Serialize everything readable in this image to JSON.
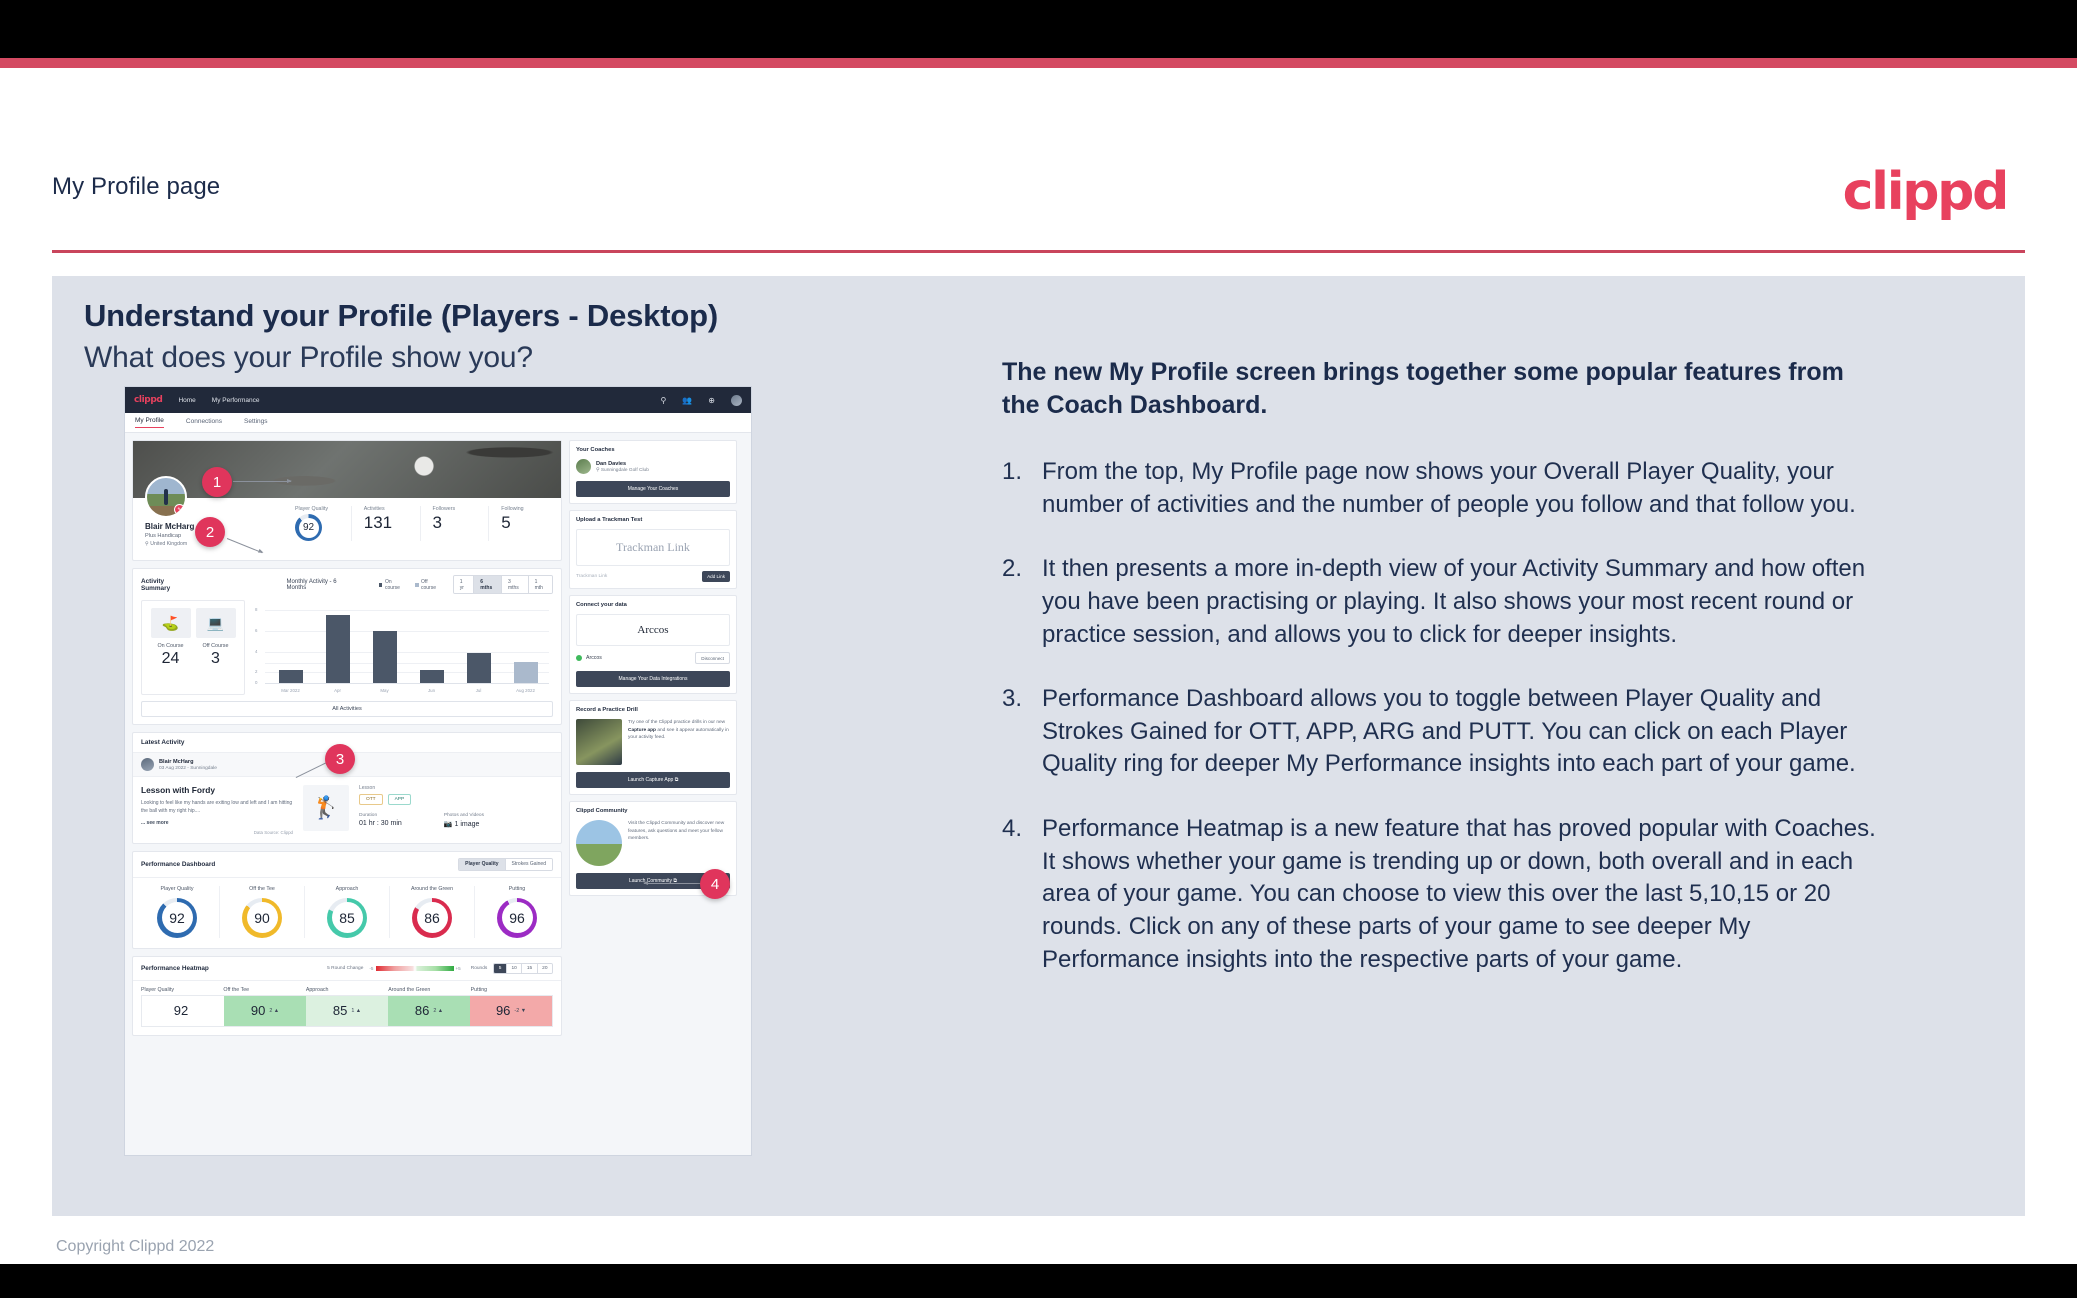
{
  "slide": {
    "title": "My Profile page",
    "logo": "clippd",
    "heading": "Understand your Profile (Players - Desktop)",
    "subheading": "What does your Profile show you?",
    "copyright": "Copyright Clippd 2022"
  },
  "copy": {
    "lede": "The new My Profile screen brings together some popular features from the Coach Dashboard.",
    "items": [
      {
        "num": "1.",
        "text": "From the top, My Profile page now shows your Overall Player Quality, your number of activities and the number of people you follow and that follow you."
      },
      {
        "num": "2.",
        "text": "It then presents a more in-depth view of your Activity Summary and how often you have been practising or playing. It also shows your most recent round or practice session, and allows you to click for deeper insights."
      },
      {
        "num": "3.",
        "text": "Performance Dashboard allows you to toggle between Player Quality and Strokes Gained for OTT, APP, ARG and PUTT. You can click on each Player Quality ring for deeper My Performance insights into each part of your game."
      },
      {
        "num": "4.",
        "text": "Performance Heatmap is a new feature that has proved popular with Coaches. It shows whether your game is trending up or down, both overall and in each area of your game. You can choose to view this over the last 5,10,15 or 20 rounds. Click on any of these parts of your game to see deeper My Performance insights into the respective parts of your game."
      }
    ]
  },
  "markers": [
    "1",
    "2",
    "3",
    "4"
  ],
  "app": {
    "nav": {
      "logo": "clippd",
      "links": [
        "Home",
        "My Performance"
      ],
      "icons": [
        "search-icon",
        "people-icon",
        "add-circle-icon",
        "avatar-icon"
      ]
    },
    "tabs": [
      {
        "label": "My Profile",
        "active": true
      },
      {
        "label": "Connections",
        "active": false
      },
      {
        "label": "Settings",
        "active": false
      }
    ],
    "profile": {
      "name": "Blair McHarg",
      "handicap": "Plus Handicap",
      "location": "United Kingdom",
      "stats": [
        {
          "label": "Player Quality",
          "value": "92",
          "ring": true
        },
        {
          "label": "Activities",
          "value": "131",
          "ring": false
        },
        {
          "label": "Followers",
          "value": "3",
          "ring": false
        },
        {
          "label": "Following",
          "value": "5",
          "ring": false
        }
      ]
    },
    "activity_summary": {
      "title": "Activity Summary",
      "chart_title": "Monthly Activity - 6 Months",
      "legend": [
        "On course",
        "Off course"
      ],
      "range_options": [
        "1 yr",
        "6 mths",
        "3 mths",
        "1 mth"
      ],
      "range_selected": "6 mths",
      "tiles": [
        {
          "label": "On Course",
          "value": "24",
          "icon": "flag-green-icon"
        },
        {
          "label": "Off Course",
          "value": "3",
          "icon": "monitor-icon"
        }
      ],
      "all_activities": "All Activities"
    },
    "latest_activity": {
      "title": "Latest Activity",
      "user": "Blair McHarg",
      "date": "03 Aug 2022 - Sunningdale",
      "headline": "Lesson with Fordy",
      "body": "Looking to feel like my hands are exiting low and left and I am hitting the ball with my right hip....",
      "see_more": "... see more",
      "source": "Data Source: Clippd",
      "type_label": "Lesson",
      "tags": [
        "OTT",
        "APP"
      ],
      "duration_label": "Duration",
      "duration_value": "01 hr : 30 min",
      "media_label": "Photos and Videos",
      "media_value": "1 image"
    },
    "performance_dashboard": {
      "title": "Performance Dashboard",
      "toggle": [
        "Player Quality",
        "Strokes Gained"
      ],
      "toggle_selected": "Player Quality",
      "rings": [
        {
          "label": "Player Quality",
          "value": "92",
          "class": "r-pq"
        },
        {
          "label": "Off the Tee",
          "value": "90",
          "class": "r-ott"
        },
        {
          "label": "Approach",
          "value": "85",
          "class": "r-app"
        },
        {
          "label": "Around the Green",
          "value": "86",
          "class": "r-arg"
        },
        {
          "label": "Putting",
          "value": "96",
          "class": "r-put"
        }
      ]
    },
    "heatmap": {
      "title": "Performance Heatmap",
      "scale_label": "5 Round Change",
      "scale_min": "-5",
      "scale_max": "+5",
      "rounds_label": "Rounds",
      "rounds_options": [
        "5",
        "10",
        "15",
        "20"
      ],
      "rounds_selected": "5",
      "cells": [
        {
          "label": "Player Quality",
          "value": "92",
          "delta": "",
          "bg": "#ffffff"
        },
        {
          "label": "Off the Tee",
          "value": "90",
          "delta": "2 ▲",
          "bg": "#a9dfb4"
        },
        {
          "label": "Approach",
          "value": "85",
          "delta": "1 ▲",
          "bg": "#dcf1e0"
        },
        {
          "label": "Around the Green",
          "value": "86",
          "delta": "2 ▲",
          "bg": "#a9dfb4"
        },
        {
          "label": "Putting",
          "value": "96",
          "delta": "-2 ▼",
          "bg": "#f3a9a9"
        }
      ]
    },
    "sidebar": {
      "coaches": {
        "title": "Your Coaches",
        "coach_name": "Dan Davies",
        "coach_club": "Sunningdale Golf Club",
        "button": "Manage Your Coaches"
      },
      "trackman": {
        "title": "Upload a Trackman Test",
        "box_text": "Trackman Link",
        "input_placeholder": "Trackman Link",
        "button": "Add Link"
      },
      "connect": {
        "title": "Connect your data",
        "box_text": "Arccos",
        "source_name": "Arccos",
        "disconnect": "Disconnect",
        "button": "Manage Your Data Integrations"
      },
      "drill": {
        "title": "Record a Practice Drill",
        "body_pre": "Try one of the Clippd practice drills in our new ",
        "body_bold": "Capture app",
        "body_post": " and see it appear automatically in your activity feed.",
        "button": "Launch Capture App ⧉"
      },
      "community": {
        "title": "Clippd Community",
        "body": "Visit the Clippd Community and discover new features, ask questions and meet your fellow members.",
        "button": "Launch Community ⧉"
      }
    }
  },
  "chart_data": {
    "type": "bar",
    "title": "Monthly Activity - 6 Months",
    "categories": [
      "Mar 2022",
      "Apr",
      "May",
      "Jun",
      "Jul",
      "Aug 2022"
    ],
    "values": [
      2,
      9,
      7,
      2,
      4,
      3
    ],
    "series_of_point": [
      "On course",
      "On course",
      "On course",
      "On course",
      "On course",
      "Off course"
    ],
    "legend": [
      "On course",
      "Off course"
    ],
    "ylim": [
      0,
      10
    ],
    "yticks": [
      0,
      2,
      4,
      6,
      8
    ],
    "xlabel": "",
    "ylabel": "",
    "grid": true,
    "legend_position": "top"
  }
}
